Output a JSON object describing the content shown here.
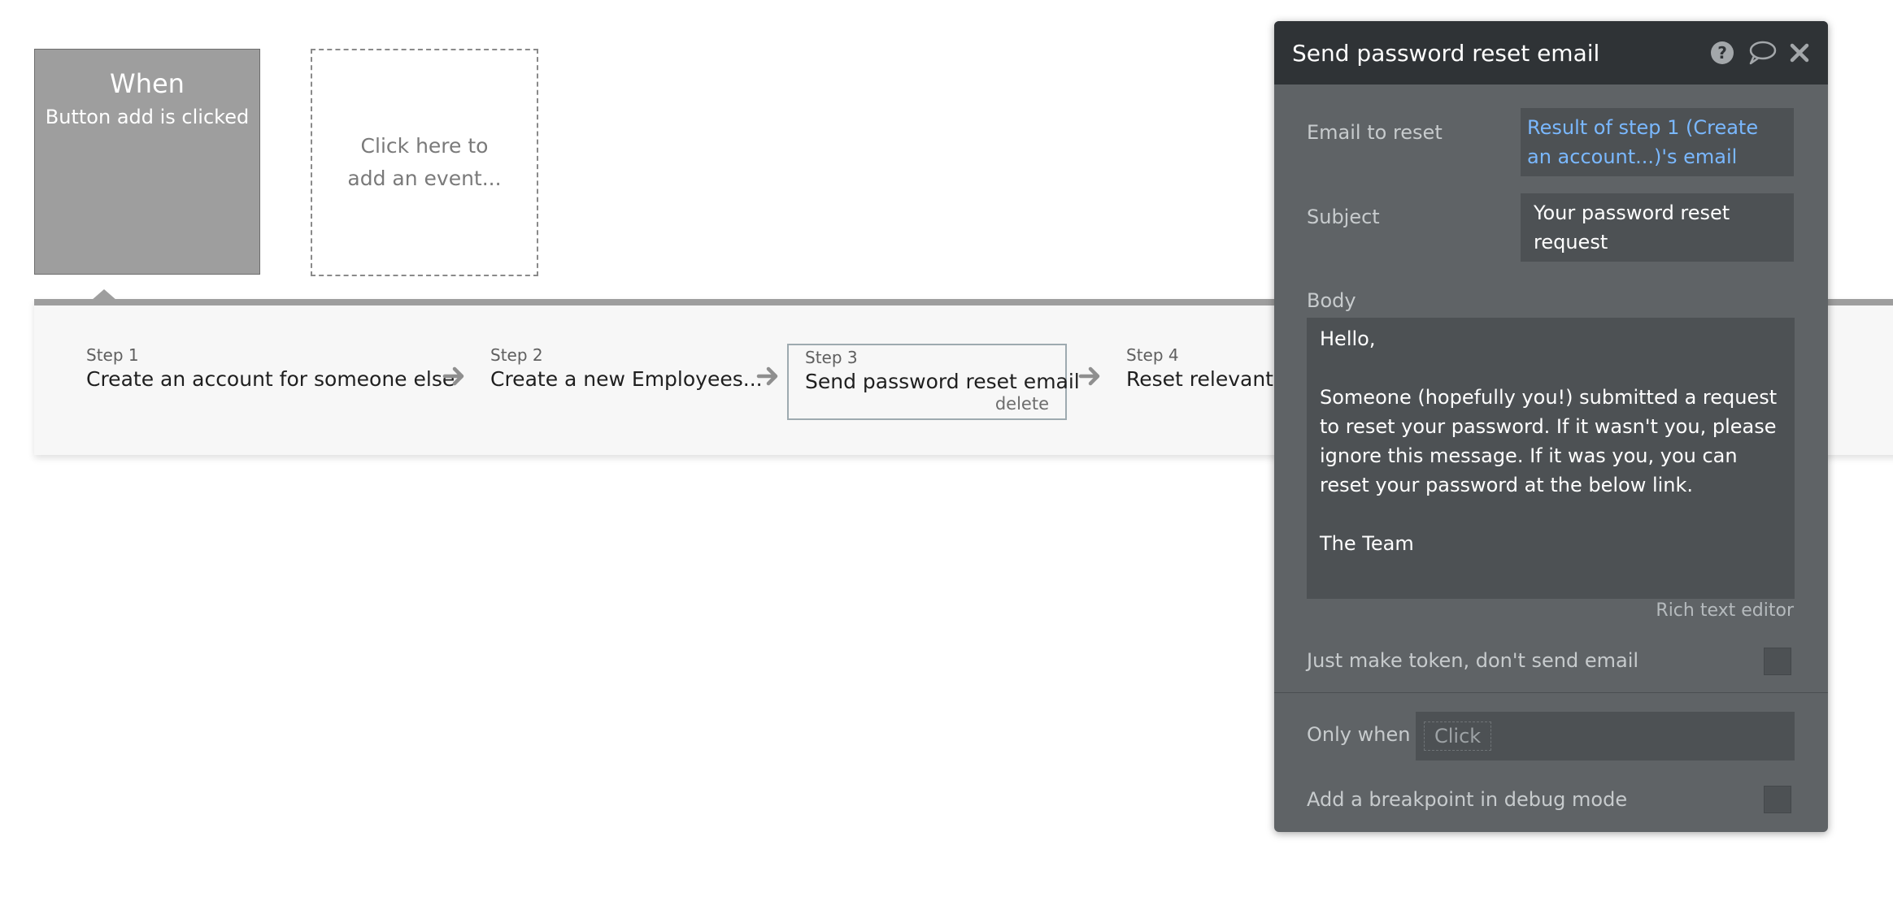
{
  "event": {
    "when_title": "When",
    "when_subtitle": "Button add is clicked",
    "add_event_text": "Click here to add an event..."
  },
  "steps": [
    {
      "number": "Step 1",
      "name": "Create an account for someone else"
    },
    {
      "number": "Step 2",
      "name": "Create a new Employees..."
    },
    {
      "number": "Step 3",
      "name": "Send password reset email",
      "delete_label": "delete"
    },
    {
      "number": "Step 4",
      "name": "Reset relevant in"
    }
  ],
  "panel": {
    "title": "Send password reset email",
    "icons": [
      "help-icon",
      "comment-icon",
      "close-icon"
    ],
    "email_label": "Email to reset",
    "email_value": "Result of step 1 (Create an account...)'s email",
    "subject_label": "Subject",
    "subject_value": "Your password reset request",
    "body_label": "Body",
    "body_value": "Hello,\n\nSomeone (hopefully you!) submitted a request to reset your password. If it wasn't you, please ignore this message. If it was you, you can reset your password at the below link.\n\nThe Team",
    "rich_text_label": "Rich text editor",
    "token_label": "Just make token, don't send email",
    "only_when_label": "Only when",
    "only_when_placeholder": "Click",
    "breakpoint_label": "Add a breakpoint in debug mode"
  },
  "colors": {
    "panel_bg": "#5f6366",
    "panel_header_bg": "#2f3336",
    "link_blue": "#7ab8ff",
    "event_card_bg": "#9e9e9e"
  }
}
